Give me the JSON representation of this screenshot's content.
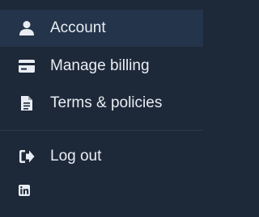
{
  "menu": {
    "items": [
      {
        "label": "Account",
        "icon": "user-icon"
      },
      {
        "label": "Manage billing",
        "icon": "credit-card-icon"
      },
      {
        "label": "Terms & policies",
        "icon": "document-icon"
      },
      {
        "label": "Log out",
        "icon": "logout-icon"
      }
    ],
    "social": {
      "icon": "linkedin-icon"
    }
  },
  "colors": {
    "background": "#1d2839",
    "active_background": "#24344a",
    "text": "#e9edf3",
    "divider": "#2f3a4b"
  }
}
